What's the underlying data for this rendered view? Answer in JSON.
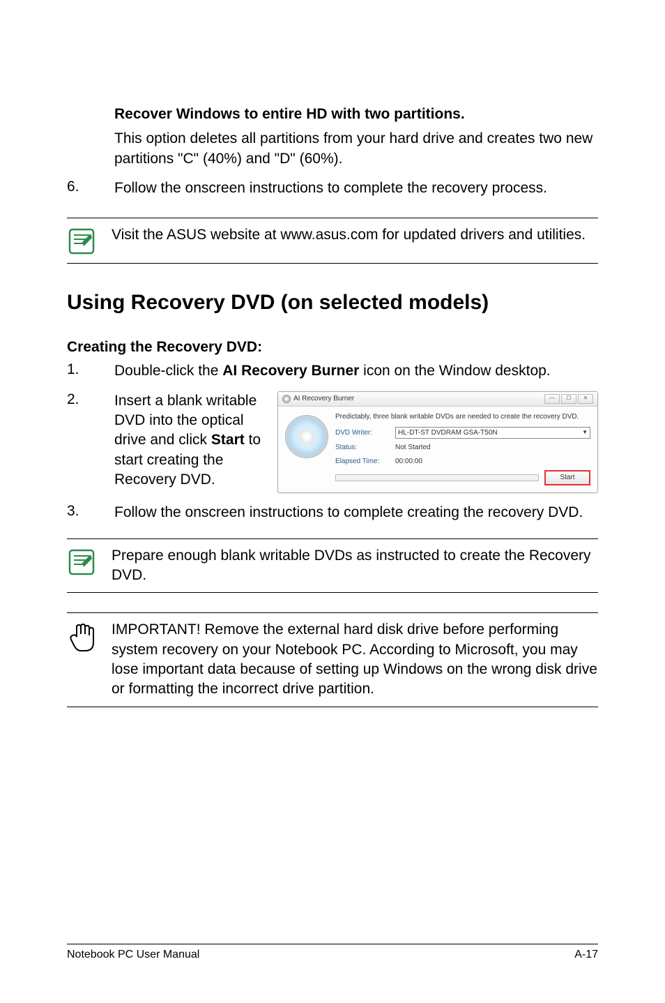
{
  "section1": {
    "heading": "Recover Windows to entire HD with two partitions.",
    "body": "This option deletes all partitions from your hard drive and creates two new partitions \"C\" (40%) and \"D\" (60%)."
  },
  "step6": {
    "num": "6.",
    "text": "Follow the onscreen instructions to complete the recovery process."
  },
  "note1": "Visit the ASUS website at www.asus.com for updated drivers and utilities.",
  "h1": "Using Recovery DVD (on selected models)",
  "h2": "Creating the Recovery DVD:",
  "step1": {
    "num": "1.",
    "pre": "Double-click the ",
    "bold": "AI Recovery Burner",
    "post": " icon on the Window desktop."
  },
  "step2": {
    "num": "2.",
    "pre": "Insert a blank writable DVD into the optical drive and click ",
    "bold": "Start",
    "post": " to start creating the Recovery DVD."
  },
  "screenshot": {
    "title": "AI Recovery Burner",
    "pred": "Predictably, three blank writable DVDs are needed to create the recovery DVD.",
    "label_writer": "DVD Writer:",
    "val_writer": "HL-DT-ST DVDRAM GSA-T50N",
    "label_status": "Status:",
    "val_status": "Not Started",
    "label_elapsed": "Elapsed Time:",
    "val_elapsed": "00:00:00",
    "start_btn": "Start"
  },
  "step3": {
    "num": "3.",
    "text": "Follow the onscreen instructions to complete creating the recovery DVD."
  },
  "note2": "Prepare enough blank writable DVDs as instructed to create the Recovery DVD.",
  "note3": "IMPORTANT! Remove the external hard disk drive before performing system recovery on your Notebook PC. According to Microsoft, you may lose important data because of setting up Windows on the wrong disk drive or formatting the incorrect drive partition.",
  "footer": {
    "left": "Notebook PC User Manual",
    "right": "A-17"
  }
}
